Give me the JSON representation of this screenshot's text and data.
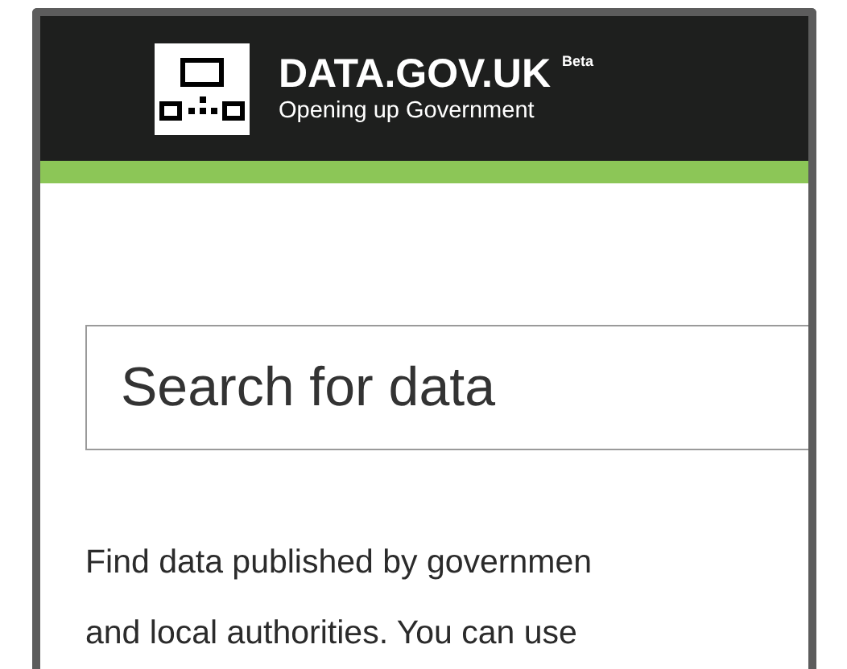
{
  "header": {
    "title": "DATA.GOV.UK",
    "badge": "Beta",
    "tagline": "Opening up Government"
  },
  "search": {
    "placeholder": "Search for data"
  },
  "intro": {
    "lines": [
      "Find data published by governmen",
      "and local authorities. You can use"
    ]
  }
}
